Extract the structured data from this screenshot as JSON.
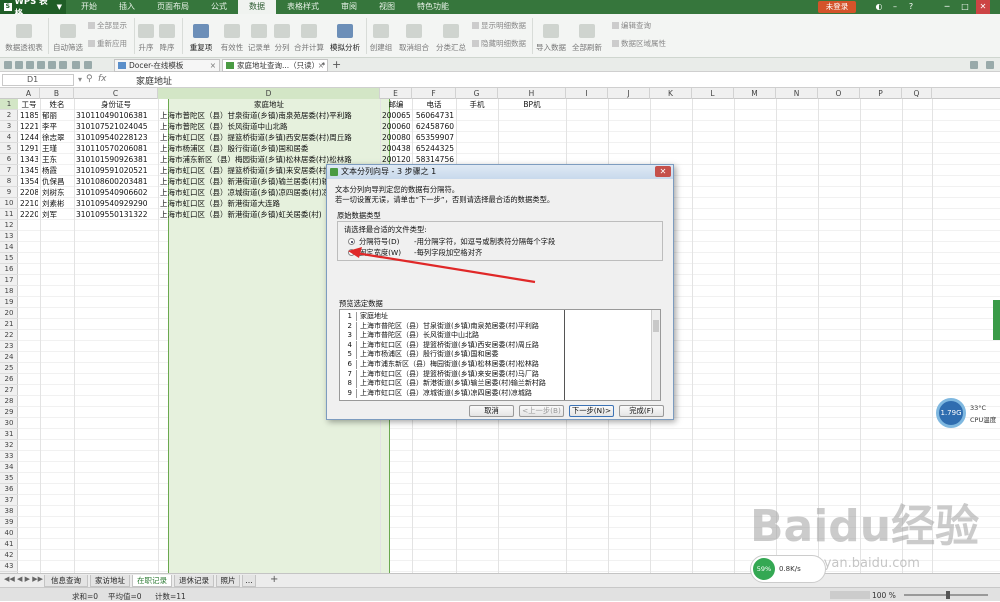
{
  "app": {
    "name": "WPS 表格",
    "login": "未登录"
  },
  "menu_tabs": [
    "开始",
    "插入",
    "页面布局",
    "公式",
    "数据",
    "表格样式",
    "审阅",
    "视图",
    "特色功能"
  ],
  "active_menu": "数据",
  "ribbon": {
    "pivot": "数据透视表",
    "autofilter": "自动筛选",
    "show_all": "全部显示",
    "reapply": "重新应用",
    "sort_asc": "升序",
    "sort_desc": "降序",
    "duplicates": "重复项",
    "validity": "有效性",
    "record": "记录单",
    "split": "分列",
    "consolidate": "合并计算",
    "simulate": "模拟分析",
    "group": "创建组",
    "ungroup": "取消组合",
    "subtotal": "分类汇总",
    "show_detail": "显示明细数据",
    "hide_detail": "隐藏明细数据",
    "import": "导入数据",
    "refresh_all": "全部刷新",
    "edit_query": "编辑查询",
    "range_props": "数据区域属性"
  },
  "doc_tabs": [
    {
      "label": "Docer-在线模板"
    },
    {
      "label": "家庭地址查询...（只读） *"
    }
  ],
  "name_box": "D1",
  "formula": "家庭地址",
  "columns": [
    "A",
    "B",
    "C",
    "D",
    "E",
    "F",
    "G",
    "H",
    "I",
    "J",
    "K",
    "L",
    "M",
    "N",
    "O",
    "P",
    "Q"
  ],
  "rows": [
    "1",
    "2",
    "3",
    "4",
    "5",
    "6",
    "7",
    "8",
    "9",
    "10",
    "11",
    "12",
    "13",
    "14",
    "15",
    "16",
    "17",
    "18",
    "19",
    "20",
    "21",
    "22",
    "23",
    "24",
    "25",
    "26",
    "27",
    "28",
    "29",
    "30",
    "31",
    "32",
    "33",
    "34",
    "35",
    "36",
    "37",
    "38",
    "39",
    "40",
    "41",
    "42",
    "43"
  ],
  "headers": {
    "a": "工号",
    "b": "姓名",
    "c": "身份证号",
    "d": "家庭地址",
    "e": "邮编",
    "f": "电话",
    "g": "手机",
    "h": "BP机"
  },
  "table": [
    [
      "1185",
      "郁丽",
      "310110490106381",
      "上海市普陀区（县）甘泉街道(乡镇)南泉苑居委(村)平利路",
      "200065",
      "56064731"
    ],
    [
      "1221",
      "李平",
      "310107521024045",
      "上海市普陀区（县）长风街道中山北路",
      "200060",
      "62458760"
    ],
    [
      "1244",
      "徐志翠",
      "310109540228123",
      "上海市虹口区（县）提篮桥街道(乡镇)西安居委(村)周丘路",
      "200080",
      "65359907"
    ],
    [
      "1291",
      "王瑾",
      "310110570206081",
      "上海市杨浦区（县）殷行街道(乡镇)国和居委",
      "200438",
      "65244325"
    ],
    [
      "1343",
      "王东",
      "310101590926381",
      "上海市浦东新区（县）梅园街道(乡镇)松林居委(村)松林路",
      "200120",
      "58314756"
    ],
    [
      "1345",
      "杨霞",
      "310109591020521",
      "上海市虹口区（县）提篮桥街道(乡镇)来安居委(村)马厂路",
      "",
      ""
    ],
    [
      "1354",
      "仇保昌",
      "310108600203481",
      "上海市虹口区（县）新港街道(乡镇)输兰居委(村)输兰新村路",
      "",
      ""
    ],
    [
      "2208",
      "刘树东",
      "310109540906602",
      "上海市虹口区（县）凉城街道(乡镇)凉四居委(村)凉城路",
      "",
      ""
    ],
    [
      "2210",
      "刘素彬",
      "310109540929290",
      "上海市虹口区（县）新港街道大连路",
      "",
      ""
    ],
    [
      "2220",
      "刘军",
      "310109550131322",
      "上海市虹口区（县）新港街道(乡镇)虹关居委(村)",
      "",
      ""
    ]
  ],
  "dialog": {
    "title": "文本分列向导 - 3 步骤之 1",
    "line1": "文本分列向导判定您的数据有分隔符。",
    "line2": "若一切设置无误，请单击“下一步”，否则请选择最合适的数据类型。",
    "group_title": "原始数据类型",
    "prompt": "请选择最合适的文件类型:",
    "opt1": "分隔符号(D)",
    "opt1_desc": "-用分隔字符，如逗号或制表符分隔每个字段",
    "opt2": "固定宽度(W)",
    "opt2_desc": "-每列字段加空格对齐",
    "preview_title": "预览选定数据",
    "preview": [
      {
        "n": "1",
        "t": "家庭地址"
      },
      {
        "n": "2",
        "t": "上海市普陀区（县）甘泉街道(乡镇)南泉苑居委(村)平利路"
      },
      {
        "n": "3",
        "t": "上海市普陀区（县）长风街道中山北路"
      },
      {
        "n": "4",
        "t": "上海市虹口区（县）提篮桥街道(乡镇)西安居委(村)周丘路"
      },
      {
        "n": "5",
        "t": "上海市杨浦区（县）殷行街道(乡镇)国和居委"
      },
      {
        "n": "6",
        "t": "上海市浦东新区（县）梅园街道(乡镇)松林居委(村)松林路"
      },
      {
        "n": "7",
        "t": "上海市虹口区（县）提篮桥街道(乡镇)来安居委(村)马厂路"
      },
      {
        "n": "8",
        "t": "上海市虹口区（县）新港街道(乡镇)输兰居委(村)输兰新村路"
      },
      {
        "n": "9",
        "t": "上海市虹口区（县）凉城街道(乡镇)凉四居委(村)凉城路"
      }
    ],
    "cancel": "取消",
    "back": "<上一步(B)",
    "next": "下一步(N)>",
    "finish": "完成(F)"
  },
  "sheet_tabs": [
    "信息查询",
    "家访地址",
    "在职记录",
    "退休记录",
    "照片",
    "…"
  ],
  "active_sheet": "在职记录",
  "status": {
    "sum": "求和=0",
    "avg": "平均值=0",
    "count": "计数=11",
    "zoom": "100 %"
  },
  "cpu": {
    "value": "1.79G",
    "temp": "33°C",
    "label": "CPU温度"
  },
  "net": {
    "value": "59%",
    "speed": "0.8K/s"
  },
  "watermark": {
    "brand": "Baidu经验",
    "url": "jingyan.baidu.com"
  }
}
